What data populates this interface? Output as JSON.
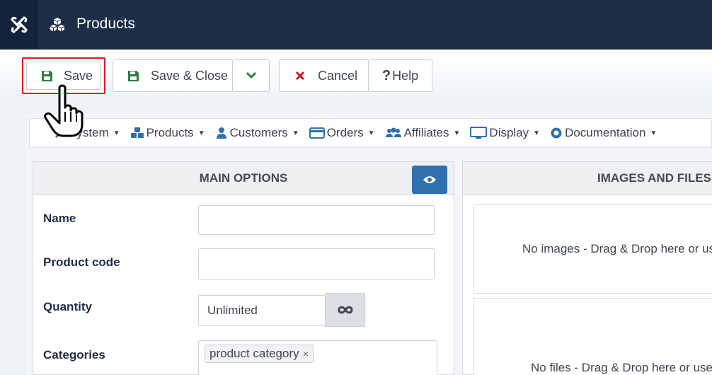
{
  "header": {
    "title": "Products",
    "logo_icon": "joomla-logo-icon",
    "title_icon": "cubes-icon",
    "colors": {
      "bar": "#1c2d48",
      "logo_bg": "#15233a"
    }
  },
  "toolbar": {
    "save_label": "Save",
    "save_close_label": "Save & Close",
    "cancel_label": "Cancel",
    "help_label": "Help",
    "highlight_color": "#e01b22"
  },
  "menu": {
    "items": [
      {
        "label": "System",
        "icon": "wrench-icon"
      },
      {
        "label": "Products",
        "icon": "cubes-icon"
      },
      {
        "label": "Customers",
        "icon": "user-icon"
      },
      {
        "label": "Orders",
        "icon": "credit-card-icon"
      },
      {
        "label": "Affiliates",
        "icon": "users-cog-icon"
      },
      {
        "label": "Display",
        "icon": "desktop-icon"
      },
      {
        "label": "Documentation",
        "icon": "life-ring-icon"
      }
    ]
  },
  "main_options": {
    "title": "MAIN OPTIONS",
    "name_label": "Name",
    "name_value": "",
    "product_code_label": "Product code",
    "product_code_value": "",
    "quantity_label": "Quantity",
    "quantity_value": "Unlimited",
    "categories_label": "Categories",
    "category_tag": "product category",
    "tag_remove": "×",
    "eye_button_color": "#2f70ad"
  },
  "images_files": {
    "title": "IMAGES AND FILES",
    "images_text": "No images - Drag & Drop here or us",
    "files_text": "No files - Drag & Drop here or use"
  }
}
